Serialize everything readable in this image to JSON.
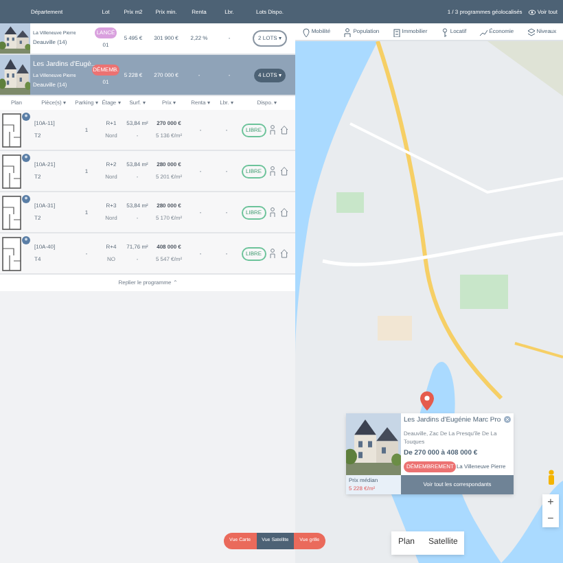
{
  "header": {
    "columns": [
      "Département",
      "Lot",
      "Prix m2",
      "Prix min.",
      "Renta",
      "Lbr.",
      "Lots Dispo."
    ]
  },
  "programs": [
    {
      "developer": "La Villeneuve Pierre",
      "city": "Deauville (14)",
      "badge": {
        "text": "LANCÉ",
        "color": "#d9a0de"
      },
      "lot": "01",
      "price_m2": "5 495 €",
      "price_min": "301 900 €",
      "renta": "2,22 %",
      "lbr": "-",
      "lots": "2 LOTS ▾",
      "selected": false
    },
    {
      "name": "Les Jardins d'Eugè...",
      "developer": "La Villeneuve Pierre",
      "city": "Deauville (14)",
      "badge": {
        "text": "DÉMEMB.",
        "color": "#ec7272"
      },
      "lot": "01",
      "price_m2": "5 228 €",
      "price_min": "270 000 €",
      "renta": "-",
      "lbr": "-",
      "lots": "4 LOTS ▾",
      "selected": true
    }
  ],
  "lots_header": [
    "Plan",
    "Pièce(s) ▾",
    "Parking ▾",
    "Étage ▾",
    "Surf. ▾",
    "Prix ▾",
    "Renta ▾",
    "Lbr. ▾",
    "Dispo. ▾"
  ],
  "lots": [
    {
      "ref": "[10A-11]",
      "type": "T2",
      "parking": "1",
      "floor": "R+1",
      "orientation": "Nord",
      "surface": "53,84 m²",
      "surface_sub": "-",
      "price": "270 000 €",
      "price_m2": "5 136 €/m²",
      "renta": "-",
      "lbr": "-",
      "status": "LIBRE"
    },
    {
      "ref": "[10A-21]",
      "type": "T2",
      "parking": "1",
      "floor": "R+2",
      "orientation": "Nord",
      "surface": "53,84 m²",
      "surface_sub": "-",
      "price": "280 000 €",
      "price_m2": "5 201 €/m²",
      "renta": "-",
      "lbr": "-",
      "status": "LIBRE"
    },
    {
      "ref": "[10A-31]",
      "type": "T2",
      "parking": "1",
      "floor": "R+3",
      "orientation": "Nord",
      "surface": "53,84 m²",
      "surface_sub": "-",
      "price": "280 000 €",
      "price_m2": "5 170 €/m²",
      "renta": "-",
      "lbr": "-",
      "status": "LIBRE"
    },
    {
      "ref": "[10A-40]",
      "type": "T4",
      "parking": "-",
      "floor": "R+4",
      "orientation": "NO",
      "surface": "71,76 m²",
      "surface_sub": "-",
      "price": "408 000 €",
      "price_m2": "5 547 €/m²",
      "renta": "-",
      "lbr": "-",
      "status": "LIBRE"
    }
  ],
  "collapse_link": "Replier le programme ⌃",
  "map": {
    "count": "1 / 3 programmes géolocalisés",
    "view_all": "Voir tout",
    "layers": [
      {
        "label": "Mobilité",
        "kind": "pin"
      },
      {
        "label": "Population",
        "kind": "person"
      },
      {
        "label": "Immobilier",
        "kind": "building"
      },
      {
        "label": "Locatif",
        "kind": "key"
      },
      {
        "label": "Économie",
        "kind": "chart"
      },
      {
        "label": "Niveaux",
        "kind": "layers"
      }
    ],
    "popup": {
      "title": "Les Jardins d'Eugénie Marc Pro",
      "address": "Deauville, Zac De La Presqu'île De La Touques",
      "price": "De 270 000 à 408 000 €",
      "badge": "DÉMEMBREMENT",
      "developer": "La Villeneuve Pierre",
      "median_label": "Prix médian",
      "median": "5 228 €/m²",
      "button": "Voir tout les correspondants"
    },
    "view_buttons": [
      {
        "label": "Vue Carte",
        "selected": false
      },
      {
        "label": "Vue Satellite",
        "selected": true
      },
      {
        "label": "Vue grille",
        "selected": false
      }
    ],
    "map_types": [
      "Plan",
      "Satellite"
    ],
    "zoom": [
      "+",
      "−"
    ]
  }
}
